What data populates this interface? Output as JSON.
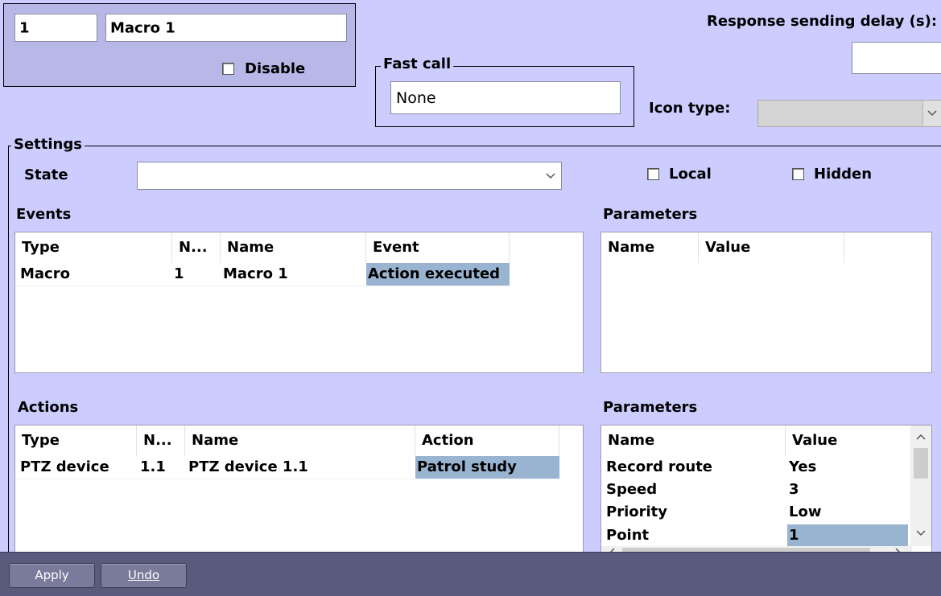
{
  "macro": {
    "id_value": "1",
    "name_value": "Macro 1",
    "disable_label": "Disable"
  },
  "fast_call": {
    "label": "Fast call",
    "value": "None"
  },
  "response_delay": {
    "label": "Response sending delay (s):",
    "value": ""
  },
  "icon_type": {
    "label": "Icon type:",
    "value": ""
  },
  "settings": {
    "label": "Settings",
    "state_label": "State",
    "state_value": "",
    "local_label": "Local",
    "hidden_label": "Hidden"
  },
  "events": {
    "label": "Events",
    "columns": [
      "Type",
      "N...",
      "Name",
      "Event"
    ],
    "rows": [
      {
        "type": "Macro",
        "num": "1",
        "name": "Macro 1",
        "event": "Action executed"
      }
    ]
  },
  "event_params": {
    "label": "Parameters",
    "columns": [
      "Name",
      "Value"
    ],
    "rows": []
  },
  "actions": {
    "label": "Actions",
    "columns": [
      "Type",
      "N...",
      "Name",
      "Action"
    ],
    "rows": [
      {
        "type": "PTZ device",
        "num": "1.1",
        "name": "PTZ device 1.1",
        "action": "Patrol study"
      }
    ]
  },
  "action_params": {
    "label": "Parameters",
    "columns": [
      "Name",
      "Value"
    ],
    "rows": [
      {
        "name": "Record route",
        "value": "Yes"
      },
      {
        "name": "Speed",
        "value": "3"
      },
      {
        "name": "Priority",
        "value": "Low"
      },
      {
        "name": "Point",
        "value": "1"
      }
    ]
  },
  "footer": {
    "apply_label": "Apply",
    "undo_label": "Undo"
  },
  "colors": {
    "background": "#ccccff",
    "footer": "#5a5a7c",
    "selection": "#99b4d1"
  }
}
